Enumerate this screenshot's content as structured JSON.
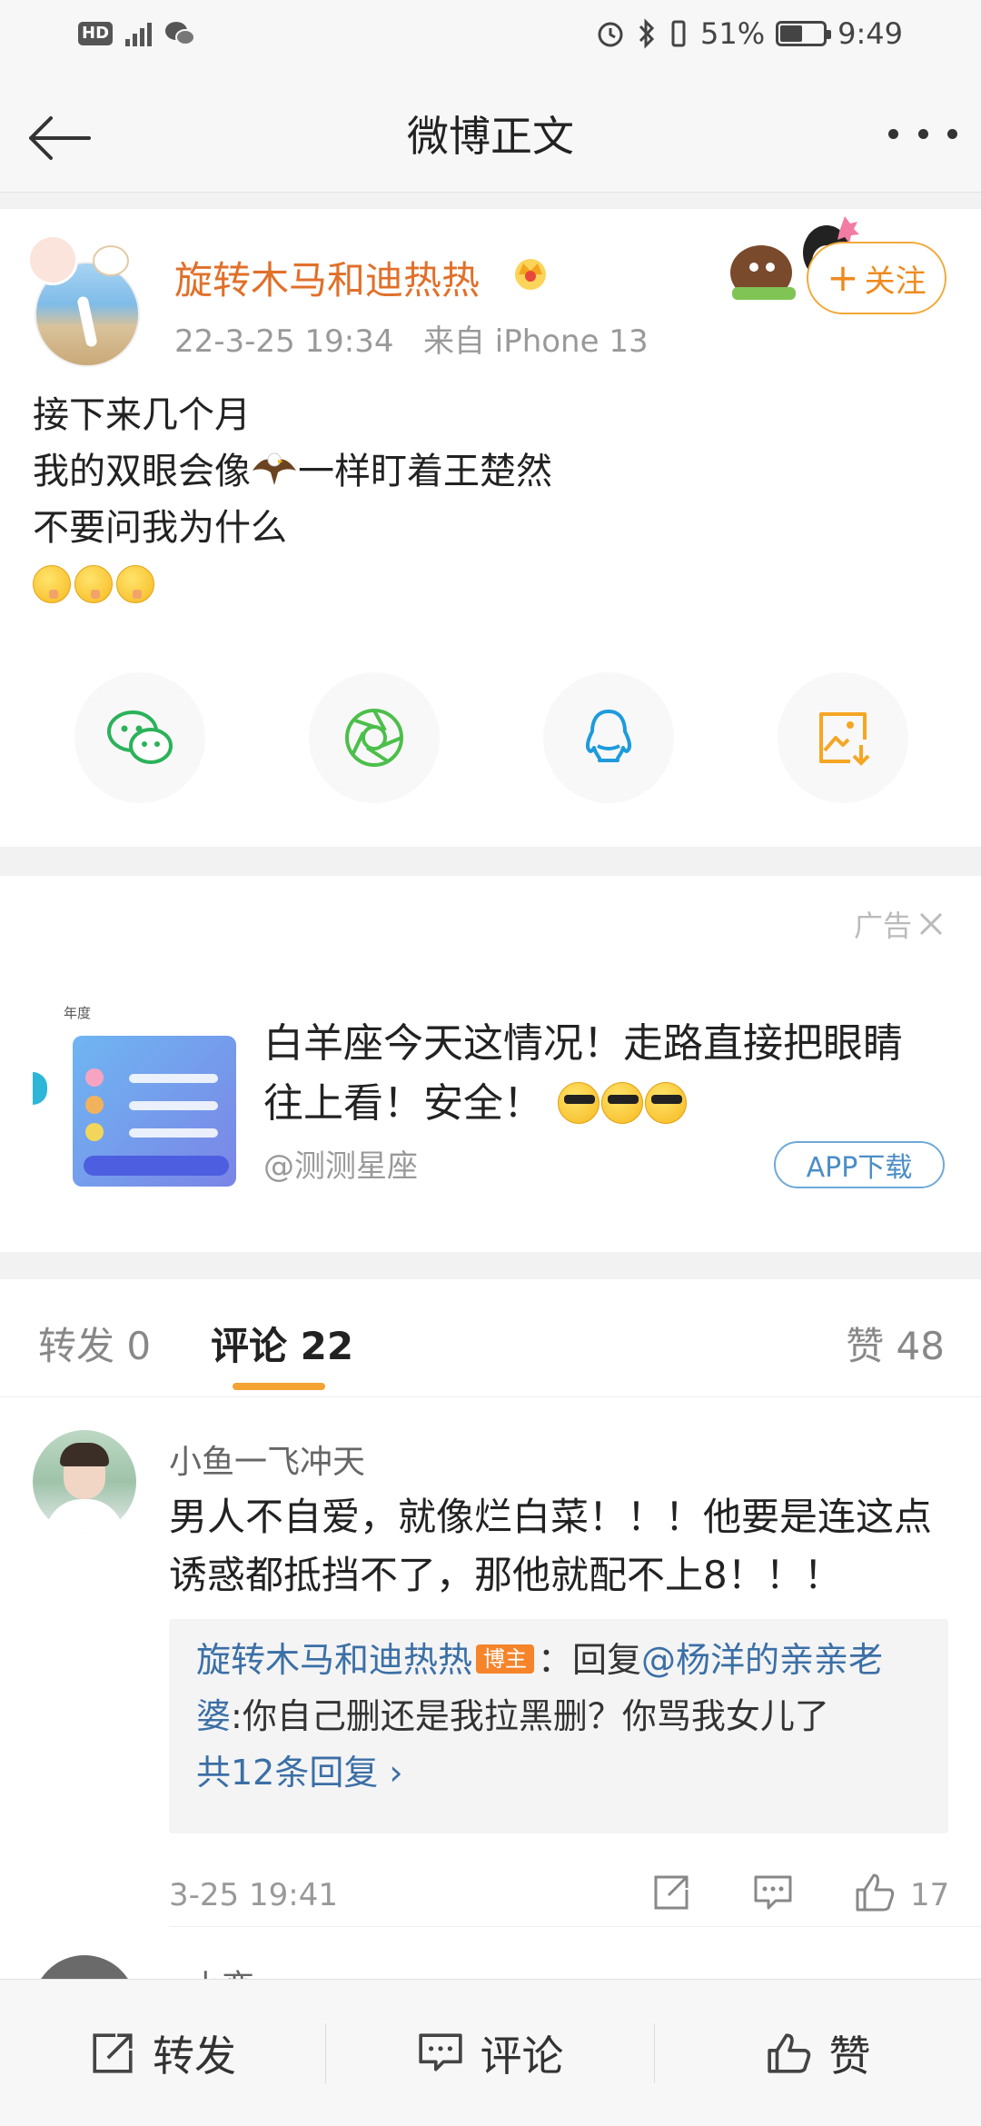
{
  "status_bar": {
    "hd_label": "HD",
    "network": "4G",
    "battery_percent": "51%",
    "battery_level": 0.51,
    "time": "9:49"
  },
  "nav": {
    "title": "微博正文",
    "back_icon": "arrow-left-icon",
    "more_icon": "more-dots-icon"
  },
  "post": {
    "author": "旋转木马和迪热热",
    "timestamp": "22-3-25 19:34",
    "source": "来自 iPhone 13",
    "follow_label": "关注",
    "lines": [
      "接下来几个月",
      "我的双眼会像",
      "一样盯着王楚然",
      "不要问我为什么"
    ],
    "emoji_count": 3,
    "share_icons": [
      {
        "name": "wechat-icon",
        "color": "#2bb25a"
      },
      {
        "name": "moments-icon",
        "color": "#4cbf4a"
      },
      {
        "name": "qq-icon",
        "color": "#1d9bdc"
      },
      {
        "name": "save-image-icon",
        "color": "#f5a623"
      }
    ]
  },
  "ad": {
    "tag": "广告",
    "thumb_year": "年度",
    "title": "白羊座今天这情况！走路直接把眼睛往上看！安全！",
    "source": "@测测星座",
    "button": "APP下载"
  },
  "tabs": {
    "repost": "转发 0",
    "comment": "评论 22",
    "like": "赞 48"
  },
  "comments": [
    {
      "user": "小鱼一飞冲天",
      "text": "男人不自爱，就像烂白菜！！！他要是连这点诱惑都抵挡不了，那他就配不上8！！！",
      "reply": {
        "name": "旋转木马和迪热热",
        "badge": "博主",
        "prefix": "：回复",
        "mention": "@杨洋的亲亲老婆",
        "text": ":你自己删还是我拉黑删？你骂我女儿了",
        "more": "共12条回复 ›"
      },
      "time": "3-25 19:41",
      "likes": "17"
    },
    {
      "user": "e小恋"
    }
  ],
  "bottom_bar": {
    "repost": "转发",
    "comment": "评论",
    "like": "赞"
  },
  "colors": {
    "accent": "#f08a1d",
    "link": "#3b6fa6",
    "tab_indicator": "#f4a232"
  }
}
